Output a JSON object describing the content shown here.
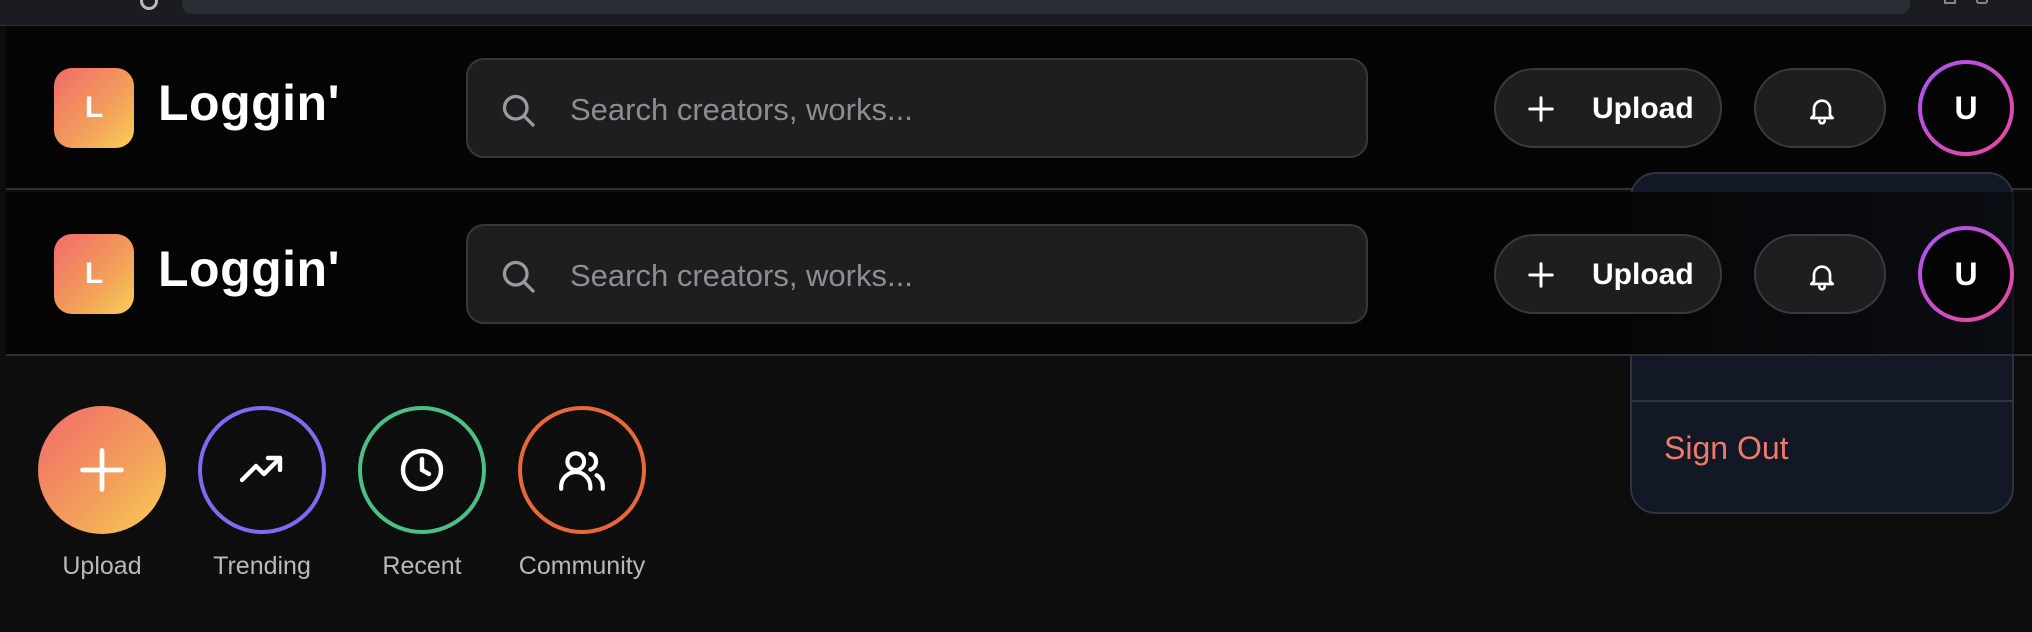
{
  "brand": {
    "logo_letter": "L",
    "name": "Loggin'"
  },
  "search": {
    "placeholder": "Search creators, works..."
  },
  "header": {
    "upload_label": "Upload",
    "avatar_initial": "U"
  },
  "user_menu": {
    "sign_out_label": "Sign Out"
  },
  "quick_actions": [
    {
      "label": "Upload",
      "icon": "plus-icon",
      "color": "#f3a05a"
    },
    {
      "label": "Trending",
      "icon": "trending-up-icon",
      "color": "#7c6cf2"
    },
    {
      "label": "Recent",
      "icon": "clock-icon",
      "color": "#4bbf85"
    },
    {
      "label": "Community",
      "icon": "users-icon",
      "color": "#e8683a"
    }
  ],
  "colors": {
    "brand_gradient_start": "#f06a6a",
    "brand_gradient_end": "#f7cf55",
    "sign_out": "#f07a6a",
    "avatar_ring": "#a855f7"
  }
}
